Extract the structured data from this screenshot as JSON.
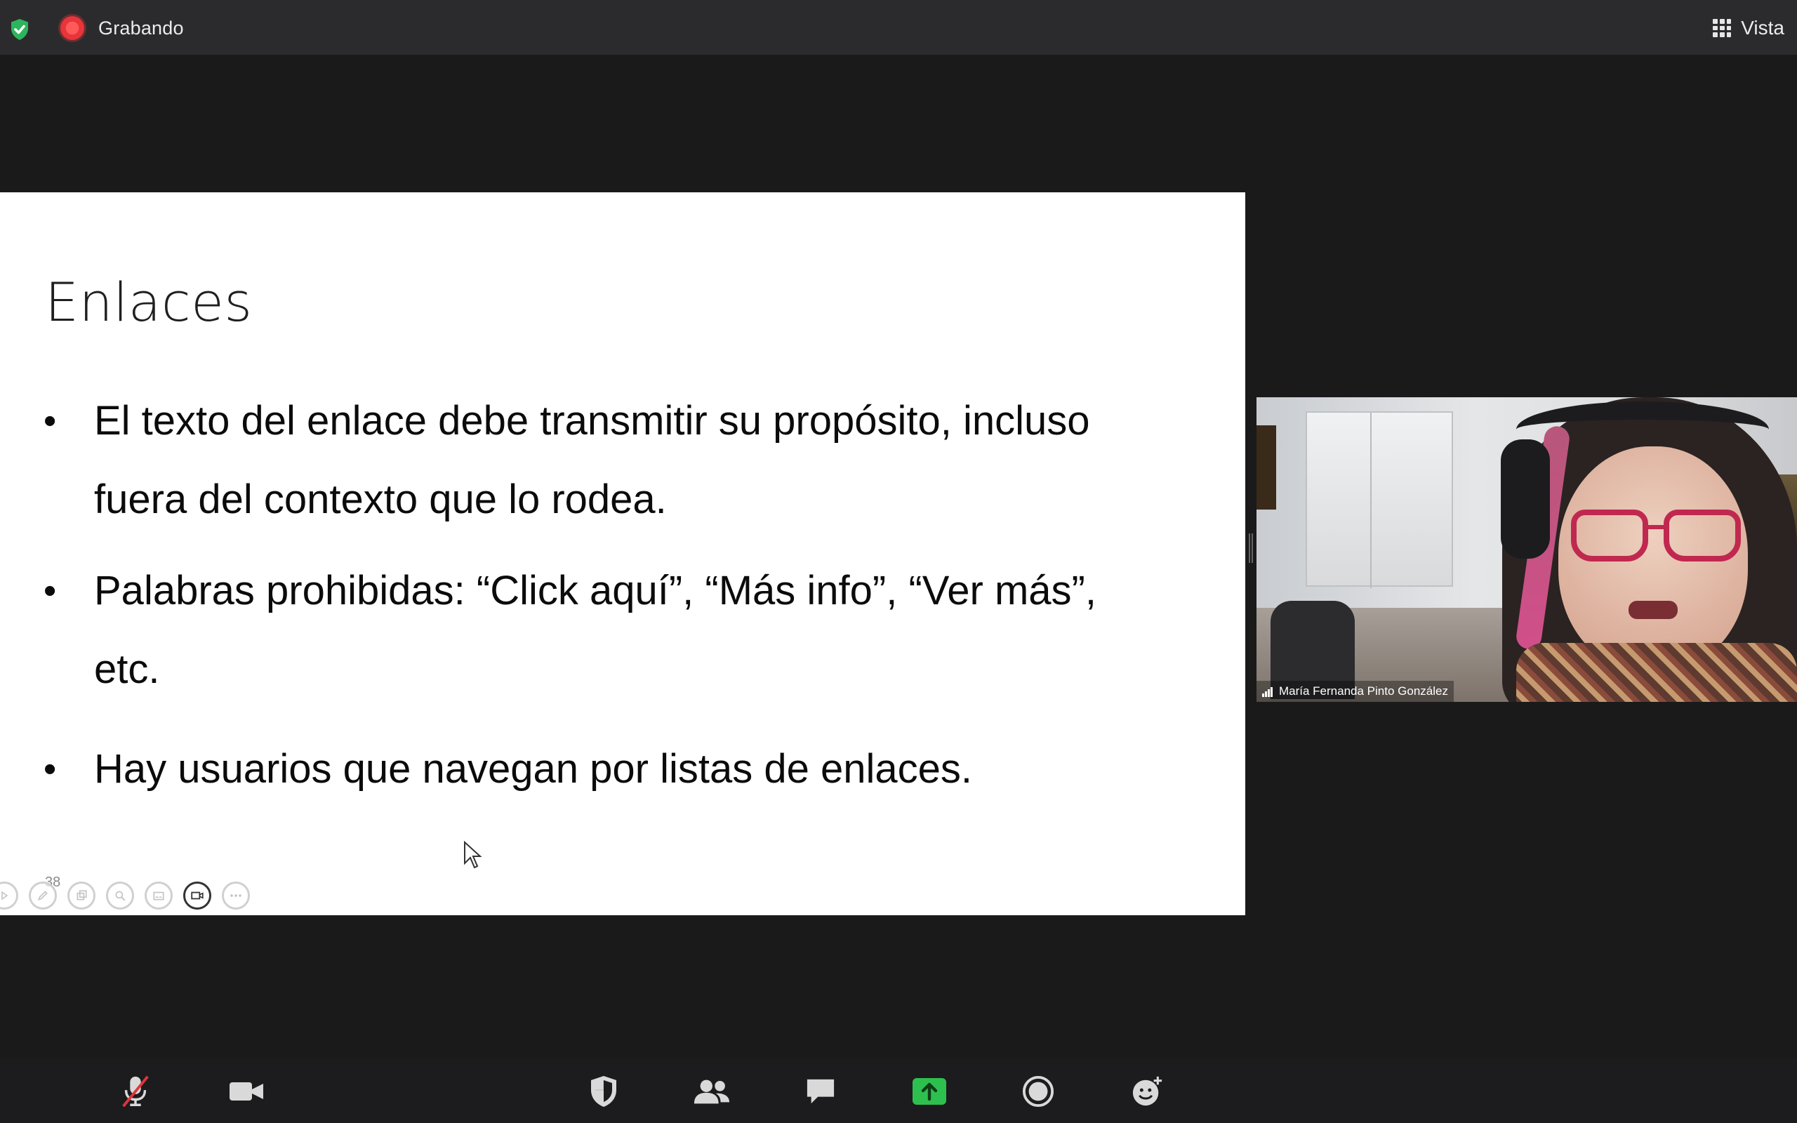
{
  "topbar": {
    "recording_label": "Grabando",
    "view_label": "Vista",
    "colors": {
      "background": "#2b2b2d",
      "shield": "#2db55d",
      "recording": "#e8353a"
    }
  },
  "slide": {
    "title": "Enlaces",
    "bullets": [
      {
        "text": "El texto del enlace debe transmitir su propósito, incluso fuera del contexto que lo rodea."
      },
      {
        "text": "Palabras prohibidas: “Click aquí”, “Más info”, “Ver más”, etc."
      },
      {
        "text": "Hay usuarios que navegan por listas de enlaces."
      }
    ],
    "slide_number": "38",
    "tools": [
      "play-icon",
      "pen-icon",
      "copy-icon",
      "zoom-icon",
      "subtitles-icon",
      "camera-icon",
      "more-icon"
    ]
  },
  "participant": {
    "name": "María Fernanda Pinto González"
  },
  "toolbar": {
    "buttons": [
      {
        "name": "mute-button",
        "icon": "microphone-muted-icon"
      },
      {
        "name": "video-button",
        "icon": "video-camera-icon"
      },
      {
        "name": "security-button",
        "icon": "shield-icon"
      },
      {
        "name": "participants-button",
        "icon": "participants-icon"
      },
      {
        "name": "chat-button",
        "icon": "chat-icon"
      },
      {
        "name": "share-screen-button",
        "icon": "share-screen-icon",
        "color": "#2ec04f"
      },
      {
        "name": "record-button",
        "icon": "record-icon"
      },
      {
        "name": "reactions-button",
        "icon": "reactions-icon"
      }
    ]
  }
}
